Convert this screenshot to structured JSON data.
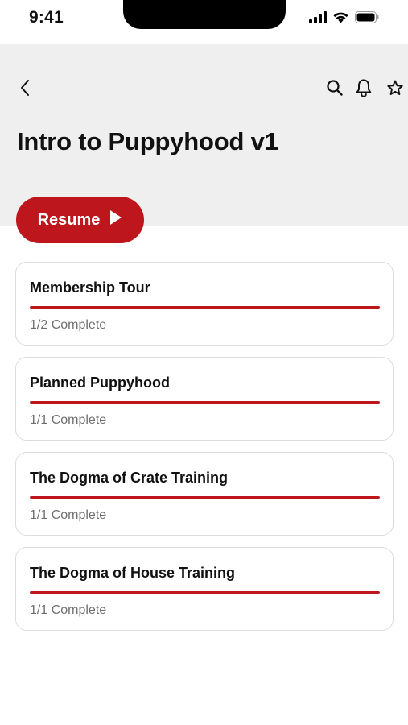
{
  "status_bar": {
    "time": "9:41",
    "icons": [
      "signal-bars-icon",
      "wifi-icon",
      "battery-icon"
    ]
  },
  "header": {
    "back_icon": "chevron-left-icon",
    "action_icons": [
      "search-icon",
      "bell-icon",
      "star-icon"
    ],
    "title": "Intro to Puppyhood v1"
  },
  "resume_button": {
    "label": "Resume",
    "icon": "play-icon",
    "color": "#bd161d"
  },
  "modules": [
    {
      "title": "Membership Tour",
      "status": "1/2 Complete",
      "progress": 1.0
    },
    {
      "title": "Planned Puppyhood",
      "status": "1/1 Complete",
      "progress": 1.0
    },
    {
      "title": "The Dogma of Crate Training",
      "status": "1/1 Complete",
      "progress": 1.0
    },
    {
      "title": "The Dogma of House Training",
      "status": "1/1 Complete",
      "progress": 1.0
    }
  ],
  "colors": {
    "accent": "#bd161d",
    "header_background": "#efefef"
  }
}
